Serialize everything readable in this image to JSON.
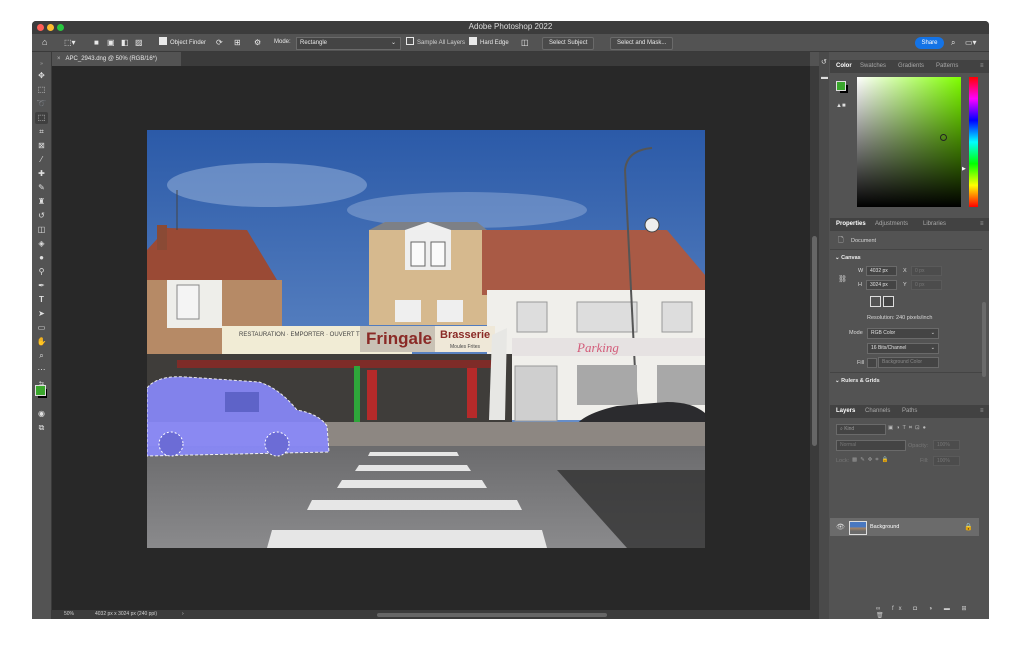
{
  "app": {
    "title": "Adobe Photoshop 2022"
  },
  "options_bar": {
    "object_finder_label": "Object Finder",
    "mode_label": "Mode:",
    "mode_value": "Rectangle",
    "sample_all_layers_label": "Sample All Layers",
    "hard_edge_label": "Hard Edge",
    "select_subject_label": "Select Subject",
    "select_and_mask_label": "Select and Mask...",
    "share_label": "Share"
  },
  "document": {
    "tab_title": "APC_2943.dng @ 50% (RGB/16*)"
  },
  "status_bar": {
    "zoom": "50%",
    "info": "4032 px x 3024 px (240 ppi)",
    "arrow": "›"
  },
  "photo_text": {
    "sign_fringale": "Fringale",
    "sign_brasserie": "Brasserie",
    "sign_moules": "Moules Frites",
    "sign_parking": "Parking"
  },
  "color_panel": {
    "tabs": [
      "Color",
      "Swatches",
      "Gradients",
      "Patterns"
    ],
    "active_tab": "Color",
    "foreground_color": "#3aa62c",
    "background_color": "#000000"
  },
  "properties_panel": {
    "tabs": [
      "Properties",
      "Adjustments",
      "Libraries"
    ],
    "active_tab": "Properties",
    "doc_label": "Document",
    "canvas_section": "Canvas",
    "w_label": "W",
    "w_value": "4032 px",
    "h_label": "H",
    "h_value": "3024 px",
    "x_label": "X",
    "x_placeholder": "0 px",
    "y_label": "Y",
    "y_placeholder": "0 px",
    "resolution": "Resolution: 240 pixels/inch",
    "mode_label": "Mode",
    "mode_value": "RGB Color",
    "bits_value": "16 Bits/Channel",
    "fill_label": "Fill",
    "fill_value": "Background Color",
    "rulers_section": "Rulers & Grids"
  },
  "layers_panel": {
    "tabs": [
      "Layers",
      "Channels",
      "Paths"
    ],
    "active_tab": "Layers",
    "kind_placeholder": "Kind",
    "blend_mode": "Normal",
    "opacity_label": "Opacity:",
    "opacity_value": "100%",
    "lock_label": "Lock:",
    "fill_label": "Fill:",
    "fill_value": "100%",
    "layers": [
      {
        "name": "Background",
        "locked": true,
        "visible": true
      }
    ]
  },
  "colors": {
    "accent": "#1473e6",
    "selection_overlay": "#8a8aff"
  }
}
